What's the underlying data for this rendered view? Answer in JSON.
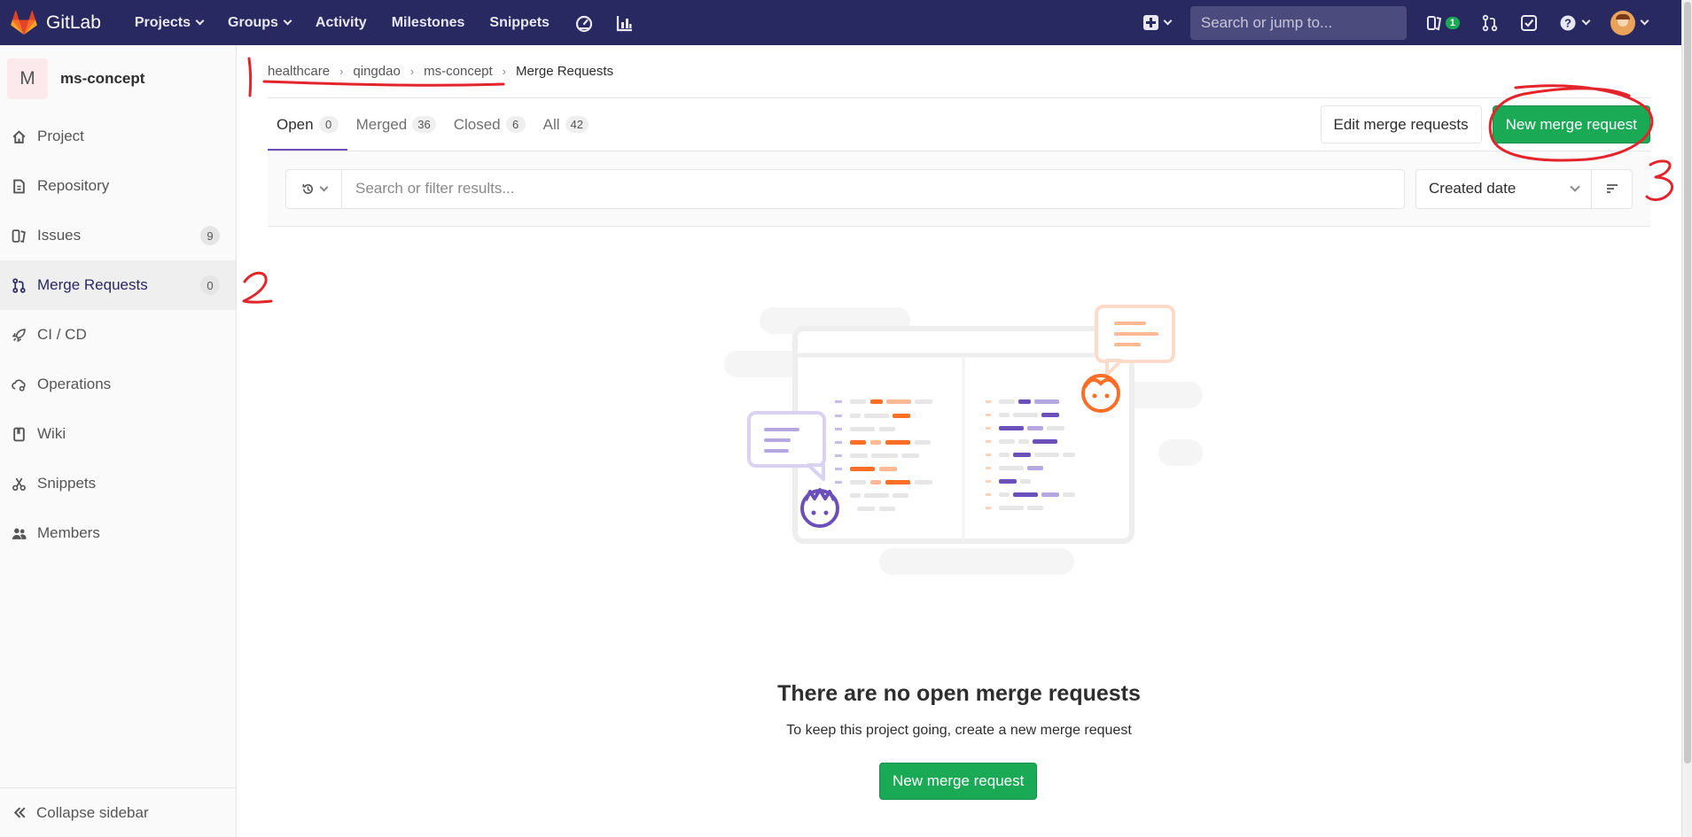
{
  "brand": {
    "name": "GitLab"
  },
  "nav": {
    "links": [
      "Projects",
      "Groups",
      "Activity",
      "Milestones",
      "Snippets"
    ],
    "search_placeholder": "Search or jump to...",
    "todo_count": "1"
  },
  "sidebar": {
    "project_initial": "M",
    "project_name": "ms-concept",
    "items": [
      {
        "label": "Project",
        "icon": "home-icon"
      },
      {
        "label": "Repository",
        "icon": "doc-icon"
      },
      {
        "label": "Issues",
        "icon": "issues-icon",
        "badge": "9"
      },
      {
        "label": "Merge Requests",
        "icon": "merge-request-icon",
        "badge": "0"
      },
      {
        "label": "CI / CD",
        "icon": "rocket-icon"
      },
      {
        "label": "Operations",
        "icon": "cloud-gear-icon"
      },
      {
        "label": "Wiki",
        "icon": "book-icon"
      },
      {
        "label": "Snippets",
        "icon": "scissors-icon"
      },
      {
        "label": "Members",
        "icon": "users-icon"
      }
    ],
    "collapse_label": "Collapse sidebar"
  },
  "breadcrumbs": [
    "healthcare",
    "qingdao",
    "ms-concept",
    "Merge Requests"
  ],
  "tabs": [
    {
      "label": "Open",
      "count": "0"
    },
    {
      "label": "Merged",
      "count": "36"
    },
    {
      "label": "Closed",
      "count": "6"
    },
    {
      "label": "All",
      "count": "42"
    }
  ],
  "buttons": {
    "edit": "Edit merge requests",
    "new": "New merge request"
  },
  "filter": {
    "placeholder": "Search or filter results...",
    "sort_value": "Created date"
  },
  "empty_state": {
    "title": "There are no open merge requests",
    "subtitle": "To keep this project going, create a new merge request",
    "button": "New merge request"
  },
  "annotations": [
    "1",
    "2",
    "3"
  ],
  "colors": {
    "navbar": "#292961",
    "success": "#1aaa55",
    "annotation": "#e3242b",
    "accent_purple": "#6b4fbb",
    "accent_orange": "#fc6d26"
  }
}
